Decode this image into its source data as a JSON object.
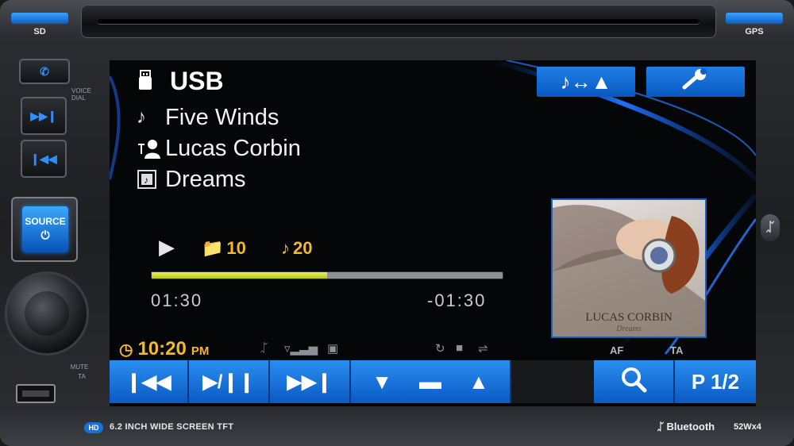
{
  "device": {
    "top_left_label": "SD",
    "top_right_label": "GPS",
    "voice_dial_label": "VOICE DIAL",
    "source_label": "SOURCE",
    "mute_label": "MUTE",
    "ta_hw_label": "TA",
    "hd_badge": "HD",
    "screen_desc": "6.2 INCH WIDE  SCREEN TFT",
    "bluetooth_brand": "Bluetooth",
    "power_spec": "52Wx4"
  },
  "now_playing": {
    "source": "USB",
    "title": "Five Winds",
    "artist": "Lucas Corbin",
    "album": "Dreams",
    "folder_number": "10",
    "track_number": "20",
    "elapsed": "01:30",
    "remaining": "-01:30",
    "progress_fraction": 0.5,
    "art_artist_text": "LUCAS CORBIN",
    "art_album_text": "Dreams"
  },
  "status": {
    "time": "10:20",
    "ampm": "PM"
  },
  "labels": {
    "af": "AF",
    "ta": "TA",
    "page": "P 1/2"
  },
  "icons": {
    "usb": "usb-icon",
    "title": "music-note-icon",
    "artist": "artist-icon",
    "album": "album-icon",
    "music_nav_swap": "music-nav-swap-icon",
    "settings": "wrench-icon"
  },
  "colors": {
    "accent_blue": "#1f7fe6",
    "clock_amber": "#f4b92a",
    "progress_fill": "#d8e23a"
  }
}
